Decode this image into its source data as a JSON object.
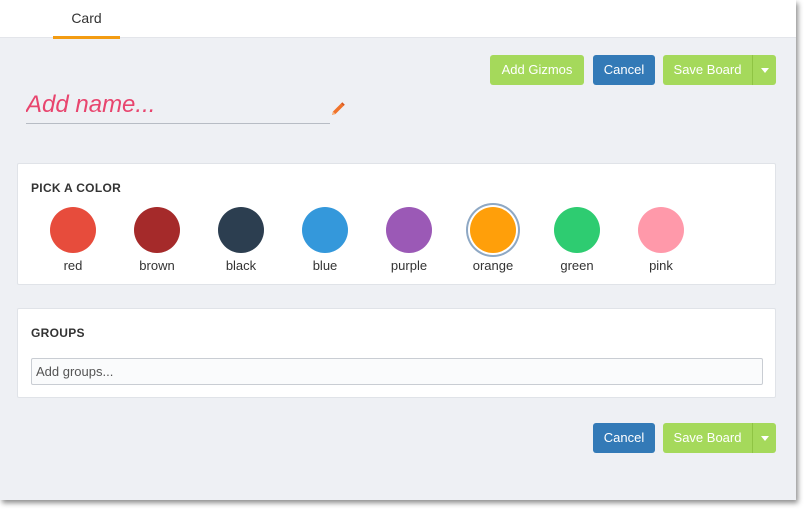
{
  "tabs": [
    {
      "label": "Card",
      "active": true
    }
  ],
  "toolbar": {
    "add_gizmos_label": "Add Gizmos",
    "cancel_label": "Cancel",
    "save_board_label": "Save Board"
  },
  "name_field": {
    "placeholder": "Add name...",
    "value": ""
  },
  "color_picker": {
    "title": "PICK A COLOR",
    "selected": "orange",
    "colors": [
      {
        "label": "red",
        "hex": "#e74c3c"
      },
      {
        "label": "brown",
        "hex": "#a52a2a"
      },
      {
        "label": "black",
        "hex": "#2c3e50"
      },
      {
        "label": "blue",
        "hex": "#3498db"
      },
      {
        "label": "purple",
        "hex": "#9b59b6"
      },
      {
        "label": "orange",
        "hex": "#ff9f0a"
      },
      {
        "label": "green",
        "hex": "#2ecc71"
      },
      {
        "label": "pink",
        "hex": "#ff99aa"
      }
    ]
  },
  "groups": {
    "title": "GROUPS",
    "placeholder": "Add groups...",
    "value": ""
  },
  "footer": {
    "cancel_label": "Cancel",
    "save_board_label": "Save Board"
  },
  "theme": {
    "accent": "#f39c12",
    "primary": "#337ab7",
    "success": "#a5d95b",
    "name_color": "#e8456e"
  },
  "icons": {
    "edit": "pencil-icon",
    "dropdown": "caret-down-icon"
  }
}
